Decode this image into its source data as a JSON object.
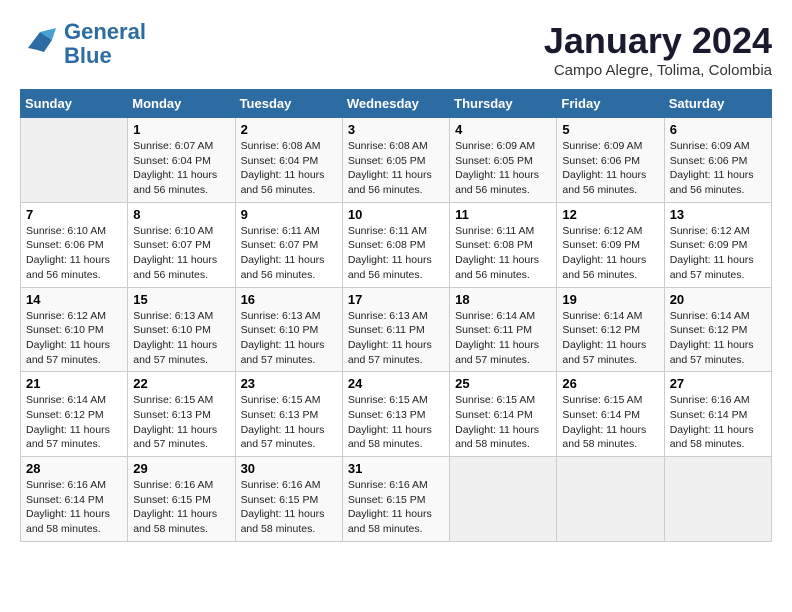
{
  "header": {
    "logo_line1": "General",
    "logo_line2": "Blue",
    "month": "January 2024",
    "location": "Campo Alegre, Tolima, Colombia"
  },
  "days_of_week": [
    "Sunday",
    "Monday",
    "Tuesday",
    "Wednesday",
    "Thursday",
    "Friday",
    "Saturday"
  ],
  "weeks": [
    [
      {
        "day": "",
        "sunrise": "",
        "sunset": "",
        "daylight": ""
      },
      {
        "day": "1",
        "sunrise": "Sunrise: 6:07 AM",
        "sunset": "Sunset: 6:04 PM",
        "daylight": "Daylight: 11 hours and 56 minutes."
      },
      {
        "day": "2",
        "sunrise": "Sunrise: 6:08 AM",
        "sunset": "Sunset: 6:04 PM",
        "daylight": "Daylight: 11 hours and 56 minutes."
      },
      {
        "day": "3",
        "sunrise": "Sunrise: 6:08 AM",
        "sunset": "Sunset: 6:05 PM",
        "daylight": "Daylight: 11 hours and 56 minutes."
      },
      {
        "day": "4",
        "sunrise": "Sunrise: 6:09 AM",
        "sunset": "Sunset: 6:05 PM",
        "daylight": "Daylight: 11 hours and 56 minutes."
      },
      {
        "day": "5",
        "sunrise": "Sunrise: 6:09 AM",
        "sunset": "Sunset: 6:06 PM",
        "daylight": "Daylight: 11 hours and 56 minutes."
      },
      {
        "day": "6",
        "sunrise": "Sunrise: 6:09 AM",
        "sunset": "Sunset: 6:06 PM",
        "daylight": "Daylight: 11 hours and 56 minutes."
      }
    ],
    [
      {
        "day": "7",
        "sunrise": "Sunrise: 6:10 AM",
        "sunset": "Sunset: 6:06 PM",
        "daylight": "Daylight: 11 hours and 56 minutes."
      },
      {
        "day": "8",
        "sunrise": "Sunrise: 6:10 AM",
        "sunset": "Sunset: 6:07 PM",
        "daylight": "Daylight: 11 hours and 56 minutes."
      },
      {
        "day": "9",
        "sunrise": "Sunrise: 6:11 AM",
        "sunset": "Sunset: 6:07 PM",
        "daylight": "Daylight: 11 hours and 56 minutes."
      },
      {
        "day": "10",
        "sunrise": "Sunrise: 6:11 AM",
        "sunset": "Sunset: 6:08 PM",
        "daylight": "Daylight: 11 hours and 56 minutes."
      },
      {
        "day": "11",
        "sunrise": "Sunrise: 6:11 AM",
        "sunset": "Sunset: 6:08 PM",
        "daylight": "Daylight: 11 hours and 56 minutes."
      },
      {
        "day": "12",
        "sunrise": "Sunrise: 6:12 AM",
        "sunset": "Sunset: 6:09 PM",
        "daylight": "Daylight: 11 hours and 56 minutes."
      },
      {
        "day": "13",
        "sunrise": "Sunrise: 6:12 AM",
        "sunset": "Sunset: 6:09 PM",
        "daylight": "Daylight: 11 hours and 57 minutes."
      }
    ],
    [
      {
        "day": "14",
        "sunrise": "Sunrise: 6:12 AM",
        "sunset": "Sunset: 6:10 PM",
        "daylight": "Daylight: 11 hours and 57 minutes."
      },
      {
        "day": "15",
        "sunrise": "Sunrise: 6:13 AM",
        "sunset": "Sunset: 6:10 PM",
        "daylight": "Daylight: 11 hours and 57 minutes."
      },
      {
        "day": "16",
        "sunrise": "Sunrise: 6:13 AM",
        "sunset": "Sunset: 6:10 PM",
        "daylight": "Daylight: 11 hours and 57 minutes."
      },
      {
        "day": "17",
        "sunrise": "Sunrise: 6:13 AM",
        "sunset": "Sunset: 6:11 PM",
        "daylight": "Daylight: 11 hours and 57 minutes."
      },
      {
        "day": "18",
        "sunrise": "Sunrise: 6:14 AM",
        "sunset": "Sunset: 6:11 PM",
        "daylight": "Daylight: 11 hours and 57 minutes."
      },
      {
        "day": "19",
        "sunrise": "Sunrise: 6:14 AM",
        "sunset": "Sunset: 6:12 PM",
        "daylight": "Daylight: 11 hours and 57 minutes."
      },
      {
        "day": "20",
        "sunrise": "Sunrise: 6:14 AM",
        "sunset": "Sunset: 6:12 PM",
        "daylight": "Daylight: 11 hours and 57 minutes."
      }
    ],
    [
      {
        "day": "21",
        "sunrise": "Sunrise: 6:14 AM",
        "sunset": "Sunset: 6:12 PM",
        "daylight": "Daylight: 11 hours and 57 minutes."
      },
      {
        "day": "22",
        "sunrise": "Sunrise: 6:15 AM",
        "sunset": "Sunset: 6:13 PM",
        "daylight": "Daylight: 11 hours and 57 minutes."
      },
      {
        "day": "23",
        "sunrise": "Sunrise: 6:15 AM",
        "sunset": "Sunset: 6:13 PM",
        "daylight": "Daylight: 11 hours and 57 minutes."
      },
      {
        "day": "24",
        "sunrise": "Sunrise: 6:15 AM",
        "sunset": "Sunset: 6:13 PM",
        "daylight": "Daylight: 11 hours and 58 minutes."
      },
      {
        "day": "25",
        "sunrise": "Sunrise: 6:15 AM",
        "sunset": "Sunset: 6:14 PM",
        "daylight": "Daylight: 11 hours and 58 minutes."
      },
      {
        "day": "26",
        "sunrise": "Sunrise: 6:15 AM",
        "sunset": "Sunset: 6:14 PM",
        "daylight": "Daylight: 11 hours and 58 minutes."
      },
      {
        "day": "27",
        "sunrise": "Sunrise: 6:16 AM",
        "sunset": "Sunset: 6:14 PM",
        "daylight": "Daylight: 11 hours and 58 minutes."
      }
    ],
    [
      {
        "day": "28",
        "sunrise": "Sunrise: 6:16 AM",
        "sunset": "Sunset: 6:14 PM",
        "daylight": "Daylight: 11 hours and 58 minutes."
      },
      {
        "day": "29",
        "sunrise": "Sunrise: 6:16 AM",
        "sunset": "Sunset: 6:15 PM",
        "daylight": "Daylight: 11 hours and 58 minutes."
      },
      {
        "day": "30",
        "sunrise": "Sunrise: 6:16 AM",
        "sunset": "Sunset: 6:15 PM",
        "daylight": "Daylight: 11 hours and 58 minutes."
      },
      {
        "day": "31",
        "sunrise": "Sunrise: 6:16 AM",
        "sunset": "Sunset: 6:15 PM",
        "daylight": "Daylight: 11 hours and 58 minutes."
      },
      {
        "day": "",
        "sunrise": "",
        "sunset": "",
        "daylight": ""
      },
      {
        "day": "",
        "sunrise": "",
        "sunset": "",
        "daylight": ""
      },
      {
        "day": "",
        "sunrise": "",
        "sunset": "",
        "daylight": ""
      }
    ]
  ]
}
